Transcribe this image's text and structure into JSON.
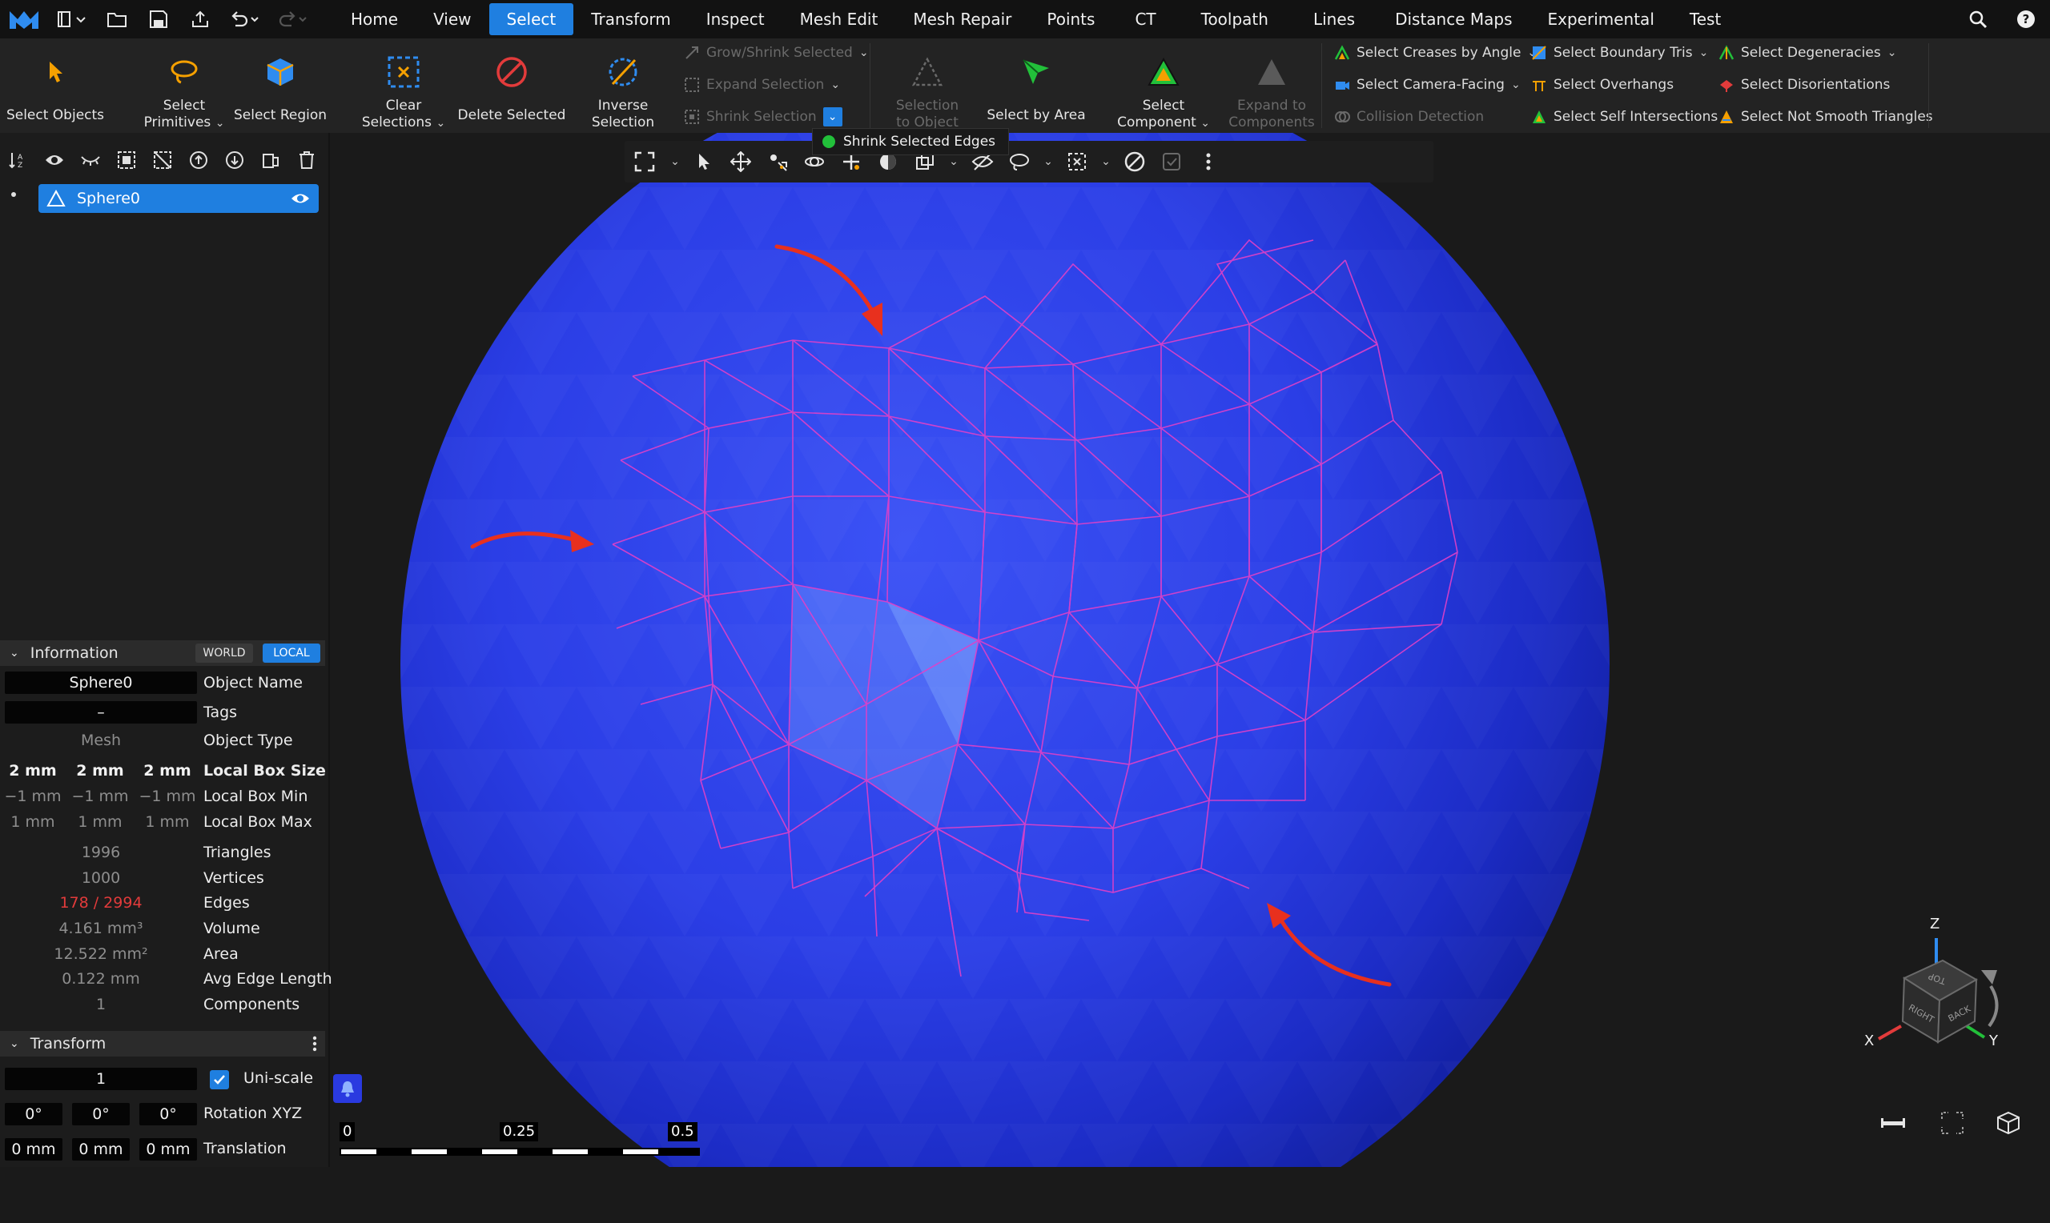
{
  "menu": {
    "tabs": [
      {
        "label": "Home",
        "active": false
      },
      {
        "label": "View",
        "active": false
      },
      {
        "label": "Select",
        "active": true
      },
      {
        "label": "Transform",
        "active": false
      },
      {
        "label": "Inspect",
        "active": false
      },
      {
        "label": "Mesh Edit",
        "active": false
      },
      {
        "label": "Mesh Repair",
        "active": false
      },
      {
        "label": "Points",
        "active": false
      },
      {
        "label": "CT",
        "active": false
      },
      {
        "label": "Toolpath",
        "active": false
      },
      {
        "label": "Lines",
        "active": false
      },
      {
        "label": "Distance Maps",
        "active": false
      },
      {
        "label": "Experimental",
        "active": false
      },
      {
        "label": "Test",
        "active": false
      }
    ],
    "accent_color": "#1f7fe0"
  },
  "ribbon": {
    "select_objects": "Select Objects",
    "select_primitives": "Select Primitives",
    "select_region": "Select Region",
    "clear_selections": "Clear Selections",
    "delete_selected": "Delete Selected",
    "inverse_selection": "Inverse Selection",
    "grow_shrink_selected": "Grow/Shrink Selected",
    "expand_selection": "Expand Selection",
    "shrink_selection": "Shrink Selection",
    "selection_to_object": "Selection to Object",
    "select_by_area": "Select by Area",
    "select_component": "Select Component",
    "expand_to_components": "Expand to Components",
    "select_creases_by_angle": "Select Creases by Angle",
    "select_camera_facing": "Select Camera-Facing",
    "collision_detection": "Collision Detection",
    "select_boundary_tris": "Select Boundary Tris",
    "select_overhangs": "Select Overhangs",
    "select_self_intersections": "Select Self Intersections",
    "select_degeneracies": "Select Degeneracies",
    "select_disorientations": "Select Disorientations",
    "select_not_smooth_triangles": "Select Not Smooth Triangles"
  },
  "tooltip": {
    "label": "Shrink Selected Edges"
  },
  "scene_tree": {
    "object_name": "Sphere0"
  },
  "information": {
    "header": "Information",
    "world": "WORLD",
    "local": "LOCAL",
    "object_name_value": "Sphere0",
    "object_name_label": "Object Name",
    "tags_value": "–",
    "tags_label": "Tags",
    "object_type_value": "Mesh",
    "object_type_label": "Object Type",
    "box_size": [
      "2 mm",
      "2 mm",
      "2 mm"
    ],
    "box_size_label": "Local Box Size",
    "box_min": [
      "−1 mm",
      "−1 mm",
      "−1 mm"
    ],
    "box_min_label": "Local Box Min",
    "box_max": [
      "1 mm",
      "1 mm",
      "1 mm"
    ],
    "box_max_label": "Local Box Max",
    "triangles_value": "1996",
    "triangles_label": "Triangles",
    "vertices_value": "1000",
    "vertices_label": "Vertices",
    "edges_value": "178 / 2994",
    "edges_label": "Edges",
    "volume_value": "4.161 mm³",
    "volume_label": "Volume",
    "area_value": "12.522 mm²",
    "area_label": "Area",
    "avg_edge_value": "0.122 mm",
    "avg_edge_label": "Avg Edge Length",
    "components_value": "1",
    "components_label": "Components"
  },
  "transform": {
    "header": "Transform",
    "scale_value": "1",
    "uniscale_label": "Uni-scale",
    "uniscale_checked": true,
    "rotation": [
      "0°",
      "0°",
      "0°"
    ],
    "rotation_label": "Rotation XYZ",
    "translation": [
      "0 mm",
      "0 mm",
      "0 mm"
    ],
    "translation_label": "Translation"
  },
  "scale_bar": {
    "labels": [
      "0",
      "0.25",
      "0.5"
    ]
  },
  "view_cube": {
    "axis_x": "X",
    "axis_y": "Y",
    "axis_z": "Z",
    "face_top": "TOP",
    "face_right": "RIGHT",
    "face_back": "BACK"
  },
  "colors": {
    "sphere": "#2a3be8",
    "selected_edges": "#e040c8",
    "annotation_arrows": "#e8301e",
    "edge_count_highlight": "#e23b3b"
  }
}
